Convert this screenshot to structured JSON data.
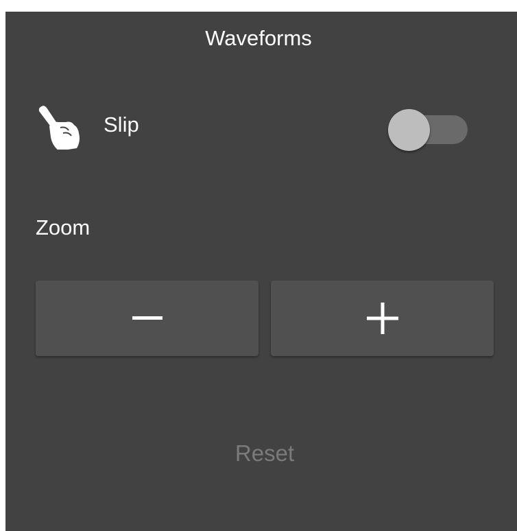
{
  "header": {
    "title": "Waveforms"
  },
  "slip": {
    "label": "Slip",
    "icon": "hand-pointer-icon",
    "enabled": false
  },
  "zoom": {
    "label": "Zoom",
    "decrease_icon": "minus-icon",
    "increase_icon": "plus-icon"
  },
  "reset": {
    "label": "Reset"
  },
  "colors": {
    "panel_background": "#424242",
    "button_background": "#505050",
    "text": "#ffffff",
    "disabled_text": "#7a7a7a",
    "toggle_thumb": "#bdbdbd",
    "toggle_track": "#6a6a6a"
  }
}
